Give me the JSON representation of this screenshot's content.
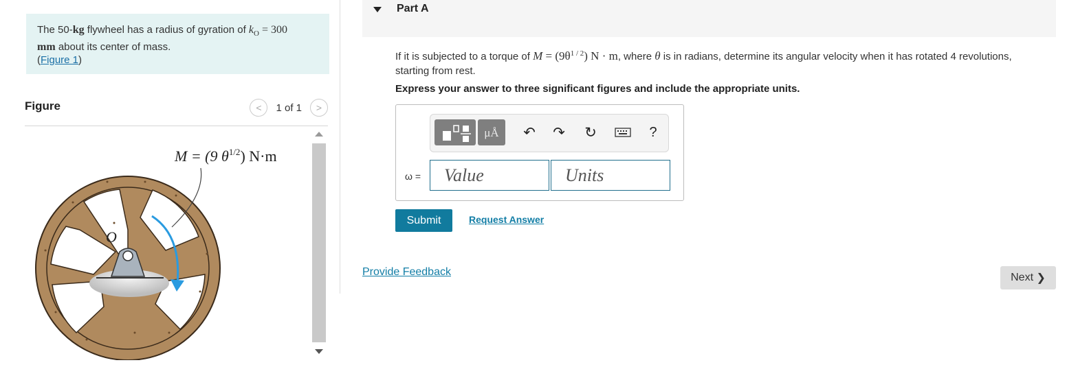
{
  "problem": {
    "text_pre": "The 50-",
    "mass_unit": "kg",
    "text_mid": " flywheel has a radius of gyration of ",
    "k_symbol": "k",
    "k_sub": "O",
    "k_eq": " = 300",
    "length_unit": "mm",
    "text_post": " about its center of mass.",
    "figure_link_open": "(",
    "figure_link": "Figure 1",
    "figure_link_close": ")"
  },
  "figure": {
    "title": "Figure",
    "pager": "1 of 1",
    "prev_glyph": "<",
    "next_glyph": ">",
    "moment_label": "M = (9 θ",
    "moment_exp": "1/2",
    "moment_unit": ") N·m",
    "point_label": "O"
  },
  "part": {
    "title": "Part A"
  },
  "question": {
    "line1_pre": "If it is subjected to a torque of ",
    "m_symbol": "M",
    "m_eq": " = (9θ",
    "m_exp": "1 / 2",
    "m_unit": ") N · m",
    "line1_post": ", where ",
    "theta": "θ",
    "line1_end": " is in radians, determine its angular velocity when it has rotated 4 revolutions, starting from rest.",
    "instruction": "Express your answer to three significant figures and include the appropriate units."
  },
  "answer": {
    "variable_label": "ω =",
    "value_placeholder": "Value",
    "units_placeholder": "Units",
    "units_tool_label": "μÅ",
    "help_label": "?"
  },
  "actions": {
    "submit": "Submit",
    "request_answer": "Request Answer",
    "provide_feedback": "Provide Feedback",
    "next": "Next",
    "next_glyph": "❯"
  },
  "colors": {
    "problem_bg": "#e4f3f3",
    "link": "#137ea6",
    "submit_bg": "#117b9e",
    "input_border": "#1f6e8c",
    "flywheel_rim": "#b08a5e",
    "arrow": "#2a9be0"
  }
}
